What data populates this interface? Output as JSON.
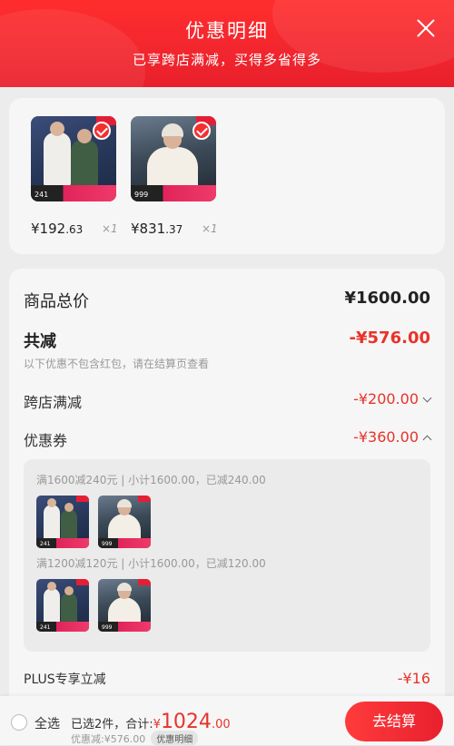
{
  "header": {
    "title": "优惠明细",
    "subtitle": "已享跨店满减，买得多省得多"
  },
  "products": [
    {
      "price_main": "¥192",
      "price_cents": ".63",
      "qty": "×1",
      "thumb_price": "241"
    },
    {
      "price_main": "¥831",
      "price_cents": ".37",
      "qty": "×1",
      "thumb_price": "999"
    }
  ],
  "summary": {
    "total_label": "商品总价",
    "total_value": "¥1600.00",
    "reduce_label": "共减",
    "reduce_value": "-¥576.00",
    "reduce_note": "以下优惠不包含红包，请在结算页查看",
    "cross_store_label": "跨店满减",
    "cross_store_value": "-¥200.00",
    "coupon_label": "优惠券",
    "coupon_value": "-¥360.00",
    "plus_label": "PLUS专享立减",
    "plus_value": "-¥16"
  },
  "coupons": [
    {
      "desc": "满1600减240元 | 小计1600.00，已减240.00"
    },
    {
      "desc": "满1200减120元 | 小计1600.00，已减120.00"
    }
  ],
  "bottom_bar": {
    "select_all": "全选",
    "selected_text": "已选2件，合计:",
    "total_symbol": "¥",
    "total_amount": "1024",
    "total_cents": ".00",
    "savings": "优惠减:¥576.00",
    "detail_pill": "优惠明细",
    "checkout": "去结算"
  },
  "colors": {
    "accent": "#e8332a",
    "header": "#f2262e"
  }
}
